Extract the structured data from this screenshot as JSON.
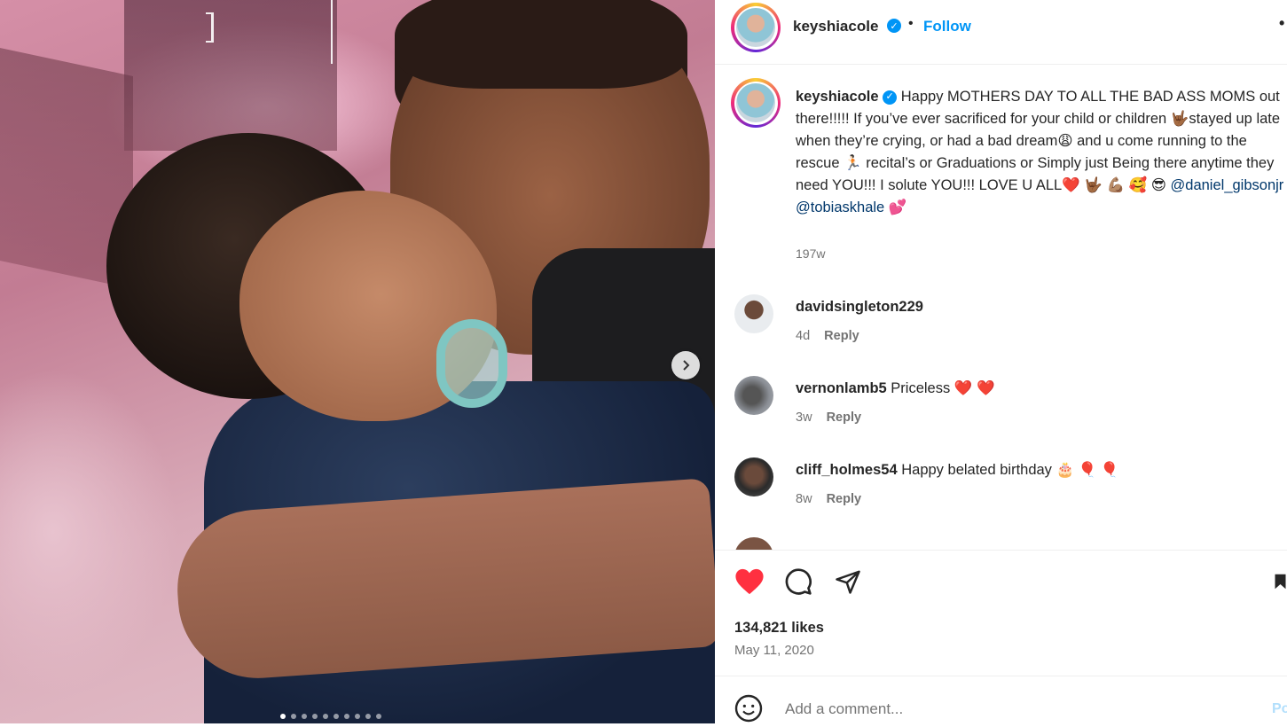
{
  "media": {
    "carousel_total": 10,
    "carousel_active_index": 0,
    "next_icon": "chevron-right-icon"
  },
  "header": {
    "username": "keyshiacole",
    "verified_icon": "verified-badge-icon",
    "separator": "•",
    "follow_label": "Follow",
    "more_icon": "ellipsis-icon"
  },
  "caption": {
    "username": "keyshiacole",
    "part1": "Happy MOTHERS DAY TO ALL THE BAD ASS MOMS out there!!!!! If you’ve ever sacrificed for your child or children ",
    "emoji1": "🤟🏾",
    "part2": "stayed up late when they’re crying, or had a bad dream",
    "emoji2": "😩",
    "part3": " and u come running to the rescue ",
    "emoji3": "🏃🏻",
    "part4": " recital’s or Graduations or Simply just Being there anytime they need YOU!!! I solute YOU!!! LOVE U ALL",
    "emoji4": "❤️ 🤟🏾 💪🏽 🥰 😎",
    "mention1": "@daniel_gibsonjr",
    "mention2": "@tobiaskhale",
    "emoji5": "💕",
    "age": "197w"
  },
  "comments": [
    {
      "username": "davidsingleton229",
      "text": "",
      "age": "4d",
      "reply": "Reply"
    },
    {
      "username": "vernonlamb5",
      "text": "Priceless ❤️ ❤️",
      "age": "3w",
      "reply": "Reply"
    },
    {
      "username": "cliff_holmes54",
      "text": "Happy belated birthday 🎂 🎈 🎈",
      "age": "8w",
      "reply": "Reply"
    }
  ],
  "actions": {
    "like_icon": "heart-icon",
    "comment_icon": "comment-icon",
    "share_icon": "share-icon",
    "save_icon": "bookmark-icon",
    "like_color": "#ff3040",
    "likes": "134,821 likes",
    "date": "May 11, 2020"
  },
  "add_comment": {
    "emoji_icon": "smiley-icon",
    "placeholder": "Add a comment...",
    "post_label": "Post"
  },
  "colors": {
    "accent": "#0095f6",
    "mention": "#00376b",
    "secondary_text": "#737373"
  }
}
